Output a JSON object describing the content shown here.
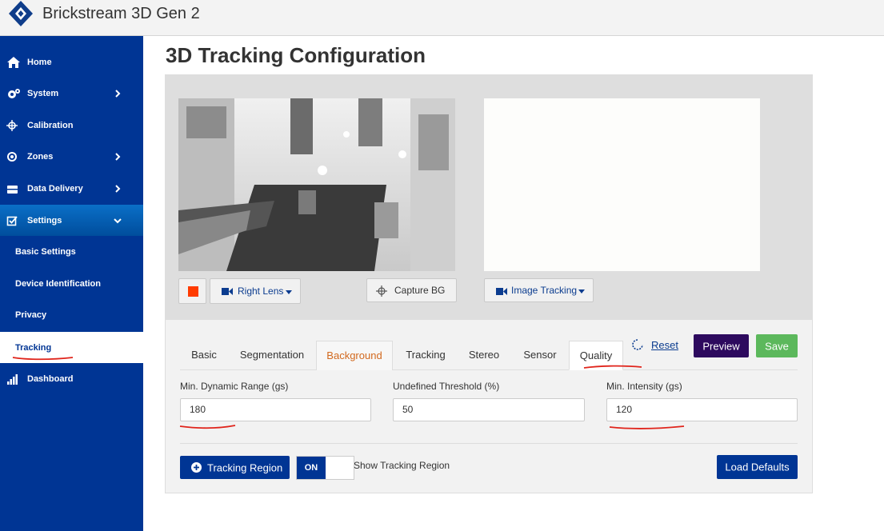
{
  "app": {
    "title": "Brickstream 3D Gen 2"
  },
  "sidebar": {
    "items": [
      {
        "label": "Home",
        "icon": "home-icon"
      },
      {
        "label": "System",
        "icon": "gears-icon",
        "chevron": "chevron-right-icon"
      },
      {
        "label": "Calibration",
        "icon": "crosshair-icon"
      },
      {
        "label": "Zones",
        "icon": "target-icon",
        "chevron": "chevron-right-icon"
      },
      {
        "label": "Data Delivery",
        "icon": "box-icon",
        "chevron": "chevron-right-icon"
      },
      {
        "label": "Settings",
        "icon": "checkbox-edit-icon",
        "chevron": "chevron-down-icon"
      },
      {
        "label": "Basic Settings"
      },
      {
        "label": "Device Identification"
      },
      {
        "label": "Privacy"
      },
      {
        "label": "Tracking"
      },
      {
        "label": "Dashboard",
        "icon": "bar-chart-icon"
      }
    ]
  },
  "main": {
    "title": "3D Tracking Configuration",
    "camera_controls": {
      "right_lens": "Right Lens",
      "capture_bg": "Capture BG",
      "image_tracking": "Image Tracking"
    },
    "tabs": [
      "Basic",
      "Segmentation",
      "Background",
      "Tracking",
      "Stereo",
      "Sensor",
      "Quality"
    ],
    "active_tab": "Quality",
    "reset": "Reset",
    "preview": "Preview",
    "save": "Save",
    "fields": {
      "min_dynamic_range": {
        "label": "Min. Dynamic Range (gs)",
        "value": "180"
      },
      "undefined_threshold": {
        "label": "Undefined Threshold (%)",
        "value": "50"
      },
      "min_intensity": {
        "label": "Min. Intensity (gs)",
        "value": "120"
      }
    },
    "tracking_region": "Tracking Region",
    "toggle": "ON",
    "show_tracking_region": "Show Tracking Region",
    "load_defaults": "Load Defaults"
  },
  "colors": {
    "sidebar": "#003594",
    "preview_button": "#2d0a5e",
    "save_button": "#5cb85c",
    "annotation": "#e0241b"
  }
}
